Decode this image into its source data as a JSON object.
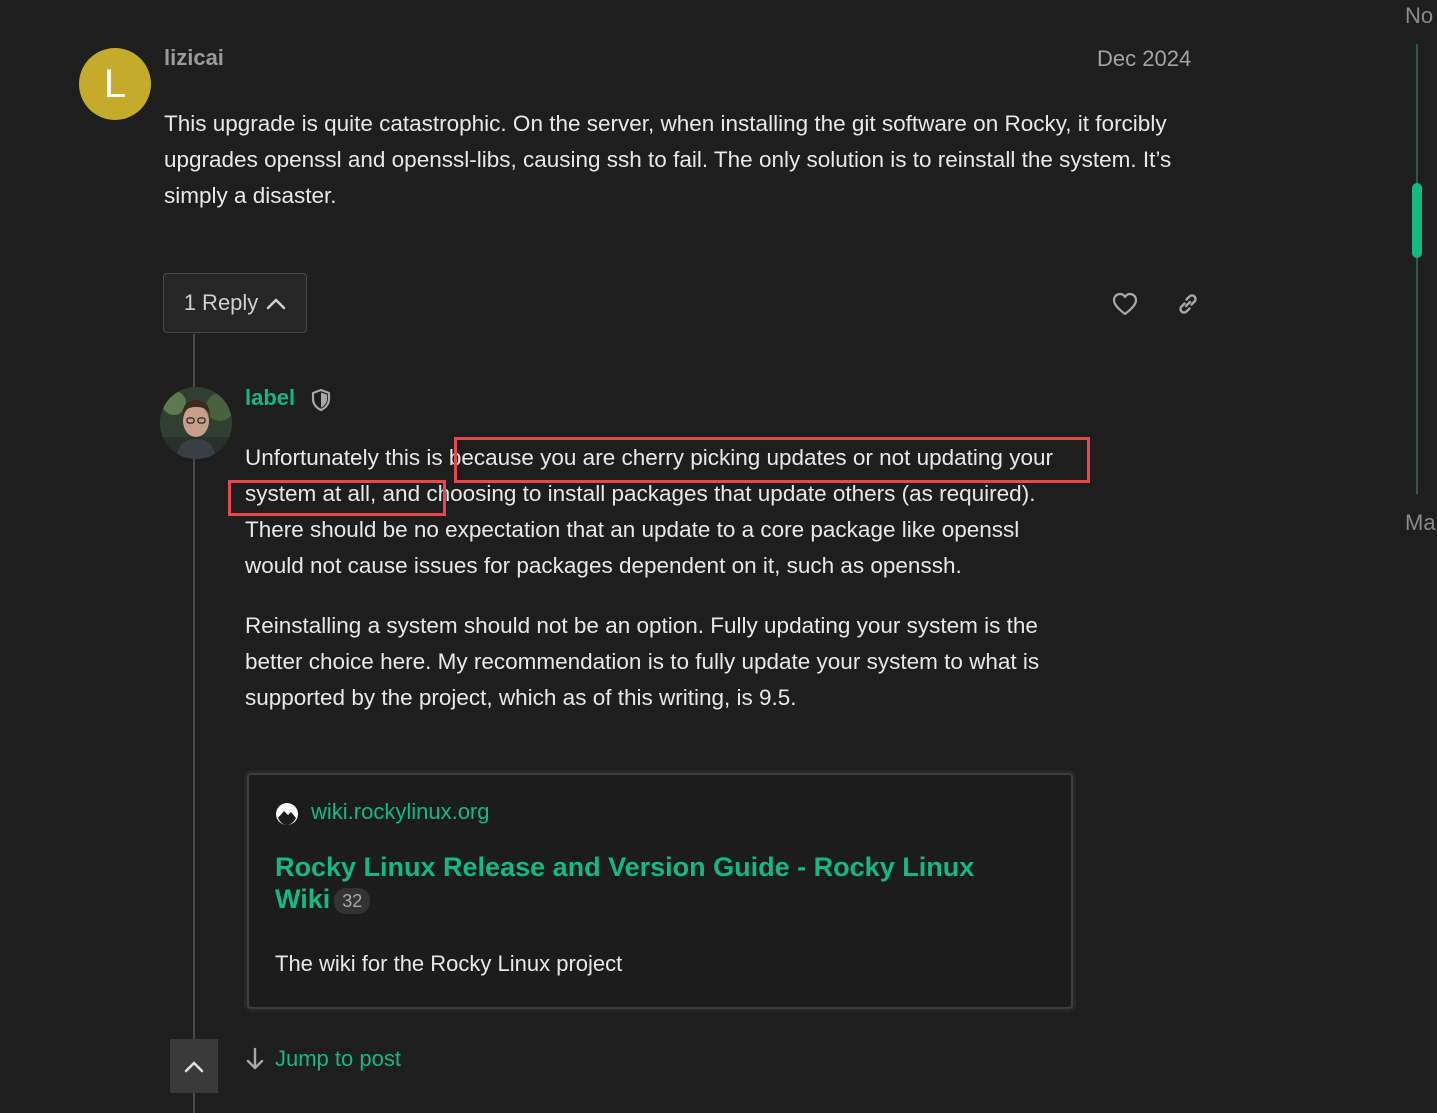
{
  "top_post": {
    "avatar_letter": "L",
    "avatar_color": "#c4ab2a",
    "username": "lizicai",
    "date": "Dec 2024",
    "body": "This upgrade is quite catastrophic. On the server, when installing the git software on Rocky, it forcibly upgrades openssl and openssl-libs, causing ssh to fail. The only solution is to reinstall the system. It’s simply a disaster.",
    "reply_button_label": "1 Reply",
    "icons": [
      "heart-icon",
      "link-icon",
      "chevron-up-icon"
    ]
  },
  "reply": {
    "username": "label",
    "username_color": "#12b981",
    "badge_icon": "shield-icon",
    "paragraph1": "Unfortunately this is because you are cherry picking updates or not updating your system at all, and choosing to install packages that update others (as required). There should be no expectation that an update to a core package like openssl would not cause issues for packages dependent on it, such as openssh.",
    "paragraph2": "Reinstalling a system should not be an option. Fully updating your system is the better choice here. My recommendation is to fully update your system to what is supported by the project, which as of this writing, is 9.5.",
    "highlight_color": "#e5484d",
    "onebox": {
      "domain": "wiki.rockylinux.org",
      "title": "Rocky Linux Release and Version Guide - Rocky Linux Wiki",
      "click_count": "32",
      "description": "The wiki for the Rocky Linux project"
    },
    "jump_label": "Jump to post"
  },
  "timeline": {
    "top_label": "No",
    "bottom_label": "Ma",
    "accent": "#12b981"
  }
}
